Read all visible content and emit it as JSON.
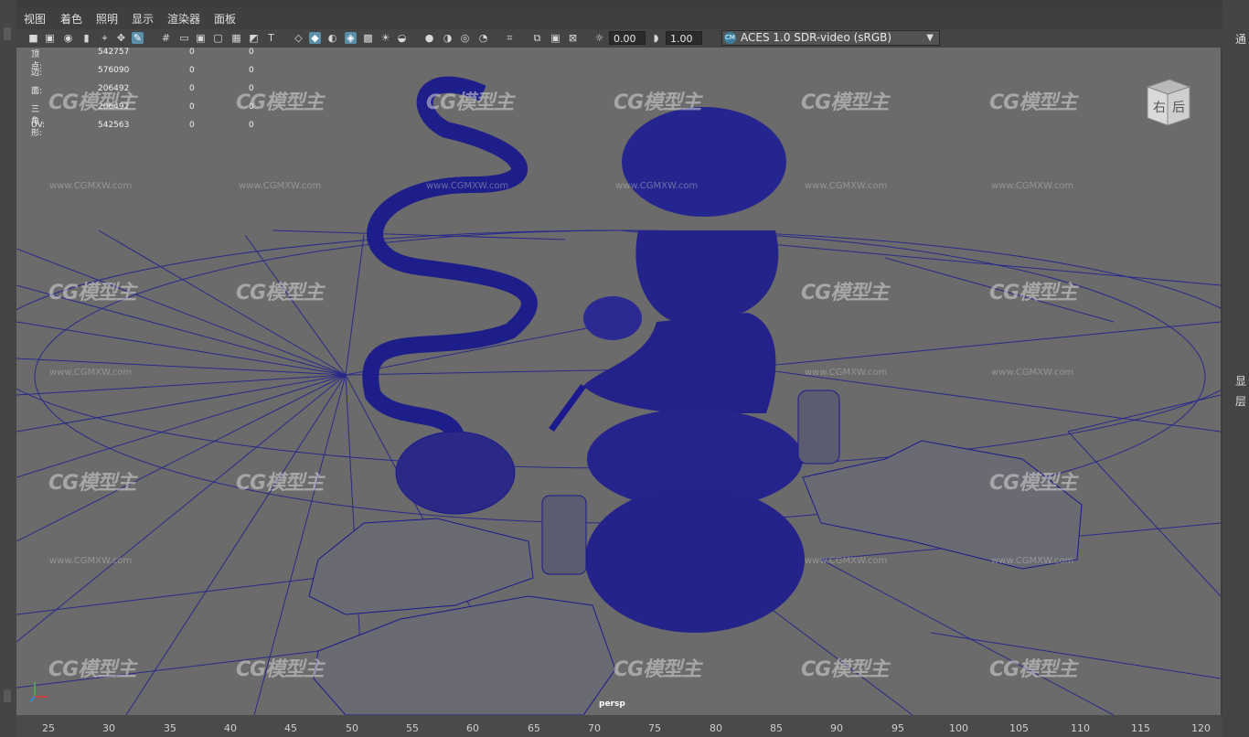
{
  "menu": {
    "items": [
      "视图",
      "着色",
      "照明",
      "显示",
      "渲染器",
      "面板"
    ]
  },
  "toolbar": {
    "exposure_value": "0.00",
    "gamma_value": "1.00",
    "color_management": "ACES 1.0 SDR-video (sRGB)",
    "icons": [
      "select-camera-icon",
      "camera-attributes-icon",
      "bookmark-icon",
      "image-plane-icon",
      "2d-pan-zoom-icon",
      "grease-pencil-icon",
      "grid-icon",
      "film-gate-icon",
      "resolution-gate-icon",
      "gate-mask-icon",
      "field-chart-icon",
      "safe-action-icon",
      "safe-title-icon",
      "wireframe-icon",
      "smooth-shade-icon",
      "default-material-icon",
      "wireframe-on-shaded-icon",
      "textured-icon",
      "lights-icon",
      "shadows-icon",
      "ambient-occlusion-icon",
      "motion-blur-icon",
      "anti-aliasing-icon",
      "depth-of-field-icon",
      "isolate-select-icon",
      "xray-icon",
      "xray-joints-icon",
      "xray-components-icon",
      "exposure-icon",
      "gamma-icon",
      "color-management-icon"
    ]
  },
  "hud": {
    "rows": [
      {
        "label": "顶点:",
        "total": "542757",
        "selected": "0",
        "components": "0"
      },
      {
        "label": "边:",
        "total": "576090",
        "selected": "0",
        "components": "0"
      },
      {
        "label": "面:",
        "total": "206492",
        "selected": "0",
        "components": "0"
      },
      {
        "label": "三角形:",
        "total": "206492",
        "selected": "0",
        "components": "0"
      },
      {
        "label": "UV:",
        "total": "542563",
        "selected": "0",
        "components": "0"
      }
    ]
  },
  "view_cube": {
    "right": "右",
    "back": "后"
  },
  "camera": "persp",
  "watermark": {
    "logo": "CG模型主",
    "url": "www.CGMXW.com"
  },
  "right_panel": {
    "top": "通",
    "mid1": "显",
    "mid2": "层"
  },
  "ruler": {
    "labels": [
      "25",
      "30",
      "35",
      "40",
      "45",
      "50",
      "55",
      "60",
      "65",
      "70",
      "75",
      "80",
      "85",
      "90",
      "95",
      "100",
      "105",
      "110",
      "115",
      "120"
    ]
  },
  "colors": {
    "wireframe": "#1a1a8c",
    "viewport_bg": "#6b6b6b",
    "accent": "#5b8fa8"
  }
}
